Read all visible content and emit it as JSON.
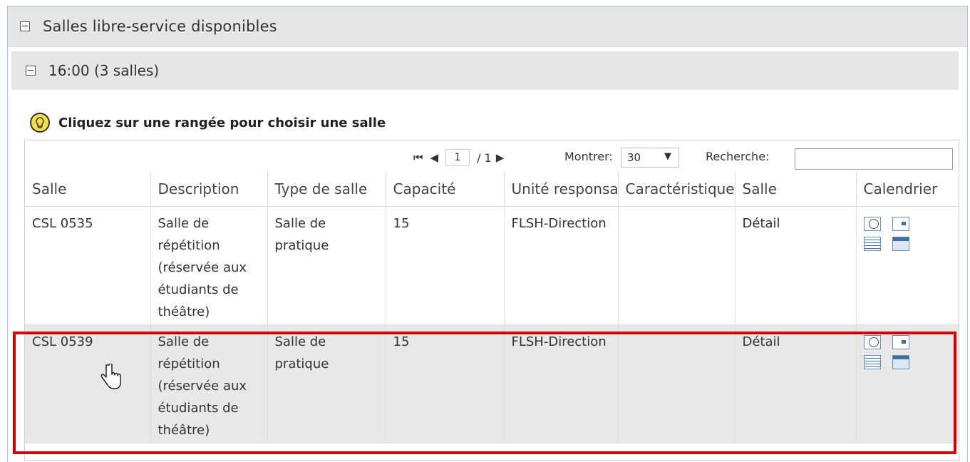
{
  "panel": {
    "title": "Salles libre-service disponibles"
  },
  "group": {
    "title": "16:00 (3 salles)"
  },
  "hint": {
    "text": "Cliquez sur une rangée pour choisir une salle",
    "icon": "lightbulb-icon"
  },
  "toolbar": {
    "page_current": "1",
    "page_total": "/ 1",
    "show_label": "Montrer:",
    "page_size": "30",
    "search_label": "Recherche:",
    "search_value": ""
  },
  "table": {
    "columns": [
      "Salle",
      "Description",
      "Type de salle",
      "Capacité",
      "Unité responsable",
      "Caractéristiques",
      "Salle",
      "Calendrier"
    ],
    "rows": [
      {
        "salle": "CSL 0535",
        "description": "Salle de répétition (réservée aux étudiants de théâtre)",
        "type": "Salle de pratique",
        "capacite": "15",
        "unite": "FLSH-Direction",
        "caracteristiques": "",
        "detail": "Détail"
      },
      {
        "salle": "CSL 0539",
        "description": "Salle de répétition (réservée aux étudiants de théâtre)",
        "type": "Salle de pratique",
        "capacite": "15",
        "unite": "FLSH-Direction",
        "caracteristiques": "",
        "detail": "Détail"
      }
    ]
  },
  "colors": {
    "highlight": "#d40000",
    "header_bg": "#e6e6e6",
    "icon_blue": "#3a6ea5"
  }
}
